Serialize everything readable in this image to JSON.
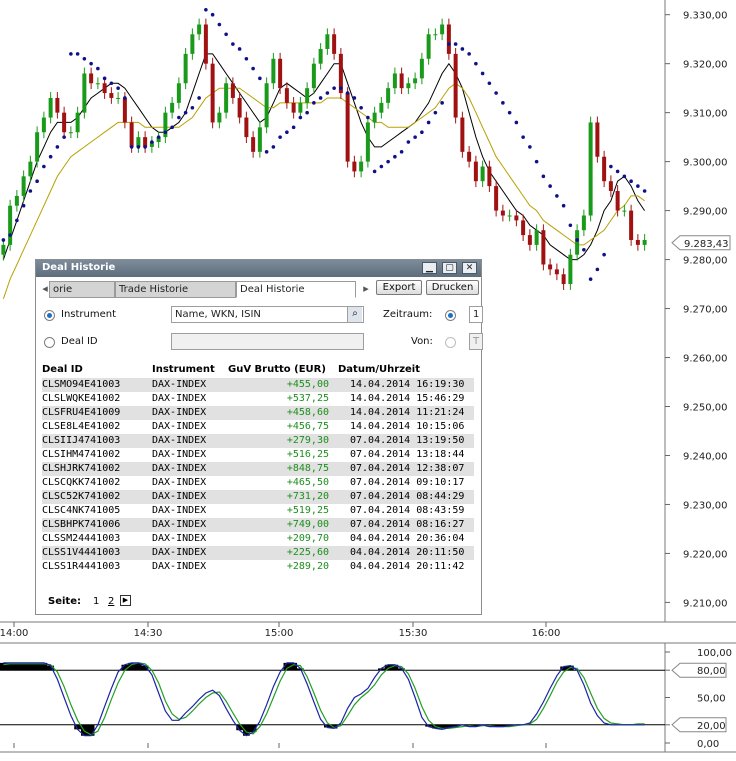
{
  "colors": {
    "candle_up": "#1a9a1a",
    "candle_down": "#a01212",
    "sar": "#10108a",
    "ma_fast": "#000000",
    "ma_slow": "#b8a100",
    "stoch_k": "#1c24a8",
    "stoch_d": "#23a023",
    "gain_text": "#1d8f1d",
    "dialog_title_bg": "#6b7b8a",
    "row_alt": "#e1e1e1"
  },
  "chart_data": [
    {
      "type": "candlestick",
      "title": "",
      "y_axis_side": "right",
      "ylim": [
        9206,
        9333
      ],
      "y_ticks": [
        "9.330,00",
        "9.320,00",
        "9.310,00",
        "9.300,00",
        "9.290,00",
        "9.280,00",
        "9.270,00",
        "9.260,00",
        "9.250,00",
        "9.240,00",
        "9.230,00",
        "9.220,00",
        "9.210,00"
      ],
      "y_tick_values": [
        9330,
        9320,
        9310,
        9300,
        9290,
        9280,
        9270,
        9260,
        9250,
        9240,
        9230,
        9220,
        9210
      ],
      "x_ticks": [
        "14:00",
        "14:30",
        "15:00",
        "15:30",
        "16:00"
      ],
      "last_price_label": "9.283,43",
      "last_price": 9283.43,
      "series": [
        {
          "kind": "close",
          "values": [
            9283,
            9291,
            9293,
            9297,
            9300,
            9306,
            9309,
            9313,
            9310,
            9306,
            9306,
            9310,
            9318,
            9316,
            9316,
            9314,
            9313,
            9313,
            9308,
            9303,
            9305,
            9303,
            9304,
            9305,
            9310,
            9312,
            9316,
            9322,
            9326,
            9328,
            9320,
            9308,
            9310,
            9316,
            9313,
            9309,
            9305,
            9302,
            9307,
            9316,
            9321,
            9315,
            9312,
            9310,
            9312,
            9315,
            9320,
            9323,
            9326,
            9322,
            9314,
            9300,
            9298,
            9300,
            9308,
            9310,
            9312,
            9315,
            9318,
            9315,
            9316,
            9317,
            9321,
            9326,
            9326,
            9328,
            9322,
            9309,
            9302,
            9300,
            9296,
            9299,
            9295,
            9290,
            9289,
            9289,
            9288,
            9285,
            9283,
            9286,
            9279,
            9278,
            9277,
            9275,
            9281,
            9286,
            9289,
            9308,
            9301,
            9296,
            9294,
            9290,
            9290,
            9284,
            9283,
            9284
          ]
        },
        {
          "kind": "sar",
          "values": [
            9284,
            9285,
            9288,
            9291,
            9294,
            9296,
            9299,
            9301,
            9303,
            9305,
            9322,
            9322,
            9321,
            9320,
            9319,
            9317,
            9316,
            9315,
            9313,
            9303,
            9303,
            9303,
            9304,
            9305,
            9306,
            9307,
            9309,
            9310,
            9311,
            9313,
            9331,
            9330,
            9328,
            9326,
            9324,
            9323,
            9321,
            9319,
            9317,
            9302,
            9303,
            9305,
            9306,
            9307,
            9309,
            9310,
            9312,
            9313,
            9314,
            9315,
            9315,
            9314,
            9313,
            9311,
            9309,
            9298,
            9299,
            9300,
            9301,
            9302,
            9304,
            9305,
            9306,
            9308,
            9310,
            9312,
            9324,
            9324,
            9323,
            9322,
            9320,
            9318,
            9316,
            9314,
            9312,
            9310,
            9308,
            9305,
            9303,
            9300,
            9297,
            9295,
            9293,
            9291,
            9287,
            9284,
            9282,
            9276,
            9278,
            9281,
            9299,
            9298,
            9297,
            9296,
            9295,
            9294
          ]
        },
        {
          "kind": "ma_fast",
          "values": [
            9280,
            9284,
            9288,
            9292,
            9296,
            9300,
            9303,
            9306,
            9308,
            9308,
            9308,
            9309,
            9311,
            9313,
            9314,
            9315,
            9316,
            9316,
            9315,
            9313,
            9311,
            9309,
            9307,
            9306,
            9306,
            9307,
            9308,
            9310,
            9314,
            9318,
            9322,
            9322,
            9320,
            9318,
            9316,
            9314,
            9312,
            9310,
            9308,
            9309,
            9312,
            9315,
            9316,
            9315,
            9314,
            9313,
            9314,
            9316,
            9318,
            9320,
            9320,
            9316,
            9312,
            9308,
            9305,
            9303,
            9303,
            9304,
            9305,
            9306,
            9307,
            9308,
            9310,
            9312,
            9315,
            9318,
            9320,
            9318,
            9315,
            9310,
            9305,
            9301,
            9298,
            9296,
            9294,
            9292,
            9290,
            9289,
            9287,
            9286,
            9285,
            9283,
            9282,
            9281,
            9280,
            9280,
            9281,
            9283,
            9286,
            9290,
            9292,
            9296,
            9297,
            9295,
            9292,
            9290
          ]
        },
        {
          "kind": "ma_slow",
          "values": [
            9272,
            9276,
            9279,
            9282,
            9285,
            9288,
            9291,
            9294,
            9297,
            9299,
            9301,
            9302,
            9303,
            9304,
            9305,
            9306,
            9307,
            9308,
            9308,
            9308,
            9308,
            9307,
            9307,
            9307,
            9307,
            9307,
            9307,
            9308,
            9309,
            9311,
            9313,
            9314,
            9315,
            9315,
            9315,
            9315,
            9314,
            9313,
            9312,
            9311,
            9311,
            9312,
            9312,
            9312,
            9312,
            9312,
            9312,
            9312,
            9313,
            9313,
            9313,
            9312,
            9311,
            9310,
            9309,
            9308,
            9308,
            9307,
            9307,
            9307,
            9307,
            9308,
            9309,
            9310,
            9311,
            9313,
            9315,
            9316,
            9315,
            9313,
            9310,
            9307,
            9304,
            9301,
            9299,
            9297,
            9295,
            9293,
            9291,
            9290,
            9288,
            9287,
            9286,
            9285,
            9284,
            9283,
            9283,
            9284,
            9285,
            9286,
            9288,
            9290,
            9291,
            9293,
            9293,
            9292
          ]
        }
      ]
    },
    {
      "type": "line",
      "title": "",
      "y_axis_side": "right",
      "ylim": [
        0,
        100
      ],
      "y_ticks": [
        "100,00",
        "80,00",
        "50,00",
        "20,00",
        "0,00"
      ],
      "y_tick_values": [
        100,
        80,
        50,
        20,
        0
      ],
      "highlighted_levels": [
        "80,00",
        "20,00"
      ],
      "reference_lines": [
        80,
        20
      ],
      "series": [
        {
          "kind": "stoch_k",
          "values": [
            88,
            88,
            88,
            88,
            88,
            88,
            88,
            85,
            70,
            50,
            30,
            15,
            8,
            8,
            20,
            40,
            60,
            78,
            86,
            88,
            88,
            85,
            75,
            55,
            35,
            25,
            25,
            33,
            40,
            48,
            55,
            58,
            52,
            38,
            25,
            14,
            8,
            12,
            24,
            42,
            62,
            78,
            88,
            88,
            82,
            65,
            45,
            26,
            17,
            16,
            22,
            38,
            50,
            54,
            60,
            72,
            82,
            86,
            86,
            82,
            70,
            50,
            28,
            18,
            16,
            15,
            17,
            18,
            20,
            18,
            18,
            20,
            18,
            18,
            18,
            19,
            20,
            20,
            22,
            32,
            45,
            60,
            74,
            84,
            85,
            80,
            64,
            44,
            30,
            22,
            20,
            20,
            20,
            20,
            20,
            20
          ]
        },
        {
          "kind": "stoch_d",
          "values": [
            86,
            87,
            87,
            87,
            87,
            87,
            87,
            86,
            78,
            62,
            42,
            25,
            13,
            9,
            13,
            28,
            48,
            66,
            80,
            86,
            88,
            87,
            80,
            66,
            46,
            32,
            26,
            28,
            35,
            43,
            50,
            55,
            56,
            46,
            33,
            21,
            12,
            10,
            18,
            32,
            50,
            68,
            82,
            86,
            85,
            73,
            55,
            36,
            22,
            17,
            19,
            30,
            42,
            50,
            56,
            64,
            75,
            82,
            85,
            84,
            76,
            60,
            40,
            25,
            18,
            16,
            16,
            17,
            18,
            19,
            18,
            19,
            19,
            18,
            18,
            18,
            19,
            20,
            21,
            26,
            38,
            52,
            67,
            78,
            83,
            82,
            72,
            55,
            38,
            27,
            22,
            21,
            20,
            20,
            21,
            21
          ]
        }
      ],
      "x_ticks": [
        "14:00",
        "14:30",
        "15:00",
        "15:30",
        "16:00"
      ]
    }
  ],
  "dialog": {
    "title": "Deal Historie",
    "tabs": [
      "orie",
      "Trade Historie",
      "Deal Historie"
    ],
    "export_label": "Export",
    "print_label": "Drucken",
    "instrument_label": "Instrument",
    "instrument_placeholder": "Name, WKN, ISIN",
    "dealid_label": "Deal ID",
    "zeitraum_label": "Zeitraum:",
    "zeitraum_value": "1",
    "von_label": "Von:",
    "von_value": "T",
    "columns": [
      "Deal ID",
      "Instrument",
      "GuV Brutto (EUR)",
      "Datum/Uhrzeit"
    ],
    "rows": [
      {
        "id": "CLSMO94E41003",
        "inst": "DAX-INDEX",
        "guv": "+455,00",
        "dt": "14.04.2014 16:19:30"
      },
      {
        "id": "CLSLWQKE41002",
        "inst": "DAX-INDEX",
        "guv": "+537,25",
        "dt": "14.04.2014 15:46:29"
      },
      {
        "id": "CLSFRU4E41009",
        "inst": "DAX-INDEX",
        "guv": "+458,60",
        "dt": "14.04.2014 11:21:24"
      },
      {
        "id": "CLSE8L4E41002",
        "inst": "DAX-INDEX",
        "guv": "+456,75",
        "dt": "14.04.2014 10:15:06"
      },
      {
        "id": "CLSIIJ4741003",
        "inst": "DAX-INDEX",
        "guv": "+279,30",
        "dt": "07.04.2014 13:19:50"
      },
      {
        "id": "CLSIHM4741002",
        "inst": "DAX-INDEX",
        "guv": "+516,25",
        "dt": "07.04.2014 13:18:44"
      },
      {
        "id": "CLSHJRK741002",
        "inst": "DAX-INDEX",
        "guv": "+848,75",
        "dt": "07.04.2014 12:38:07"
      },
      {
        "id": "CLSCQKK741002",
        "inst": "DAX-INDEX",
        "guv": "+465,50",
        "dt": "07.04.2014 09:10:17"
      },
      {
        "id": "CLSC52K741002",
        "inst": "DAX-INDEX",
        "guv": "+731,20",
        "dt": "07.04.2014 08:44:29"
      },
      {
        "id": "CLSC4NK741005",
        "inst": "DAX-INDEX",
        "guv": "+519,25",
        "dt": "07.04.2014 08:43:59"
      },
      {
        "id": "CLSBHPK741006",
        "inst": "DAX-INDEX",
        "guv": "+749,00",
        "dt": "07.04.2014 08:16:27"
      },
      {
        "id": "CLSSM24441003",
        "inst": "DAX-INDEX",
        "guv": "+209,70",
        "dt": "04.04.2014 20:36:04"
      },
      {
        "id": "CLSS1V4441003",
        "inst": "DAX-INDEX",
        "guv": "+225,60",
        "dt": "04.04.2014 20:11:50"
      },
      {
        "id": "CLSS1R4441003",
        "inst": "DAX-INDEX",
        "guv": "+289,20",
        "dt": "04.04.2014 20:11:42"
      }
    ],
    "pager_label": "Seite:",
    "pages": [
      "1",
      "2"
    ],
    "next_icon": "play-icon"
  }
}
